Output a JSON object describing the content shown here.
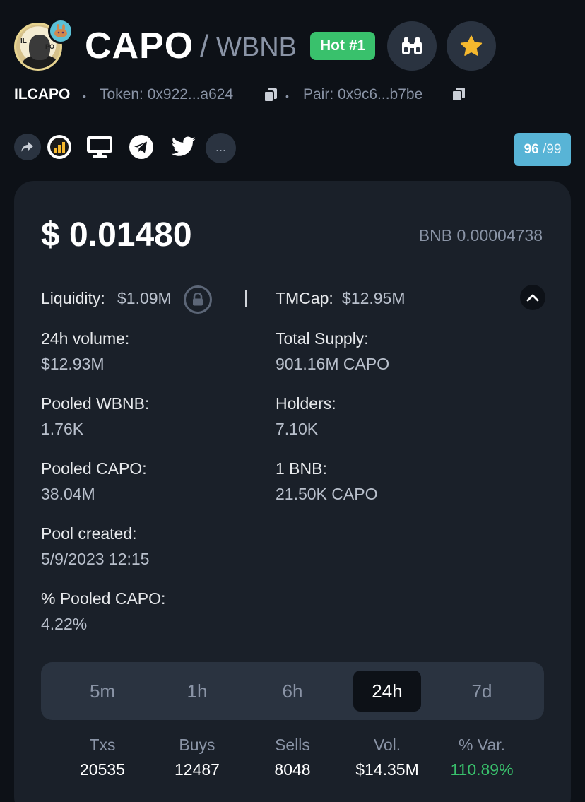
{
  "header": {
    "symbol": "CAPO",
    "slash": "/",
    "quote": "WBNB",
    "hot_badge": "Hot #1",
    "name": "ILCAPO",
    "token_label": "Token: 0x922...a624",
    "pair_label": "Pair: 0x9c6...b7be",
    "avatar_text_left": "IL",
    "avatar_text_right": "PO"
  },
  "score": {
    "value": "96",
    "max": "/99"
  },
  "more_label": "...",
  "price": {
    "usd": "$ 0.01480",
    "bnb": "BNB 0.00004738"
  },
  "stats_left": [
    {
      "label": "Liquidity:",
      "value": "$1.09M"
    },
    {
      "label": "24h volume:",
      "value": "$12.93M"
    },
    {
      "label": "Pooled WBNB:",
      "value": "1.76K"
    },
    {
      "label": "Pooled CAPO:",
      "value": "38.04M"
    },
    {
      "label": "Pool created:",
      "value": "5/9/2023 12:15"
    },
    {
      "label": "% Pooled CAPO:",
      "value": "4.22%"
    }
  ],
  "stats_right": [
    {
      "label": "TMCap:",
      "value": "$12.95M"
    },
    {
      "label": "Total Supply:",
      "value": "901.16M CAPO"
    },
    {
      "label": "Holders:",
      "value": "7.10K"
    },
    {
      "label": "1 BNB:",
      "value": "21.50K CAPO"
    }
  ],
  "timeframes": [
    "5m",
    "1h",
    "6h",
    "24h",
    "7d"
  ],
  "active_timeframe": "24h",
  "tx_stats": {
    "headers": [
      "Txs",
      "Buys",
      "Sells",
      "Vol.",
      "% Var."
    ],
    "values": [
      "20535",
      "12487",
      "8048",
      "$14.35M",
      "110.89%"
    ]
  },
  "colors": {
    "background": "#0d1117",
    "card": "#1a2029",
    "accent_green": "#39c16c",
    "score_blue": "#58b4d6",
    "star_gold": "#f5b82e"
  },
  "icons": [
    "share-icon",
    "chart-logo-icon",
    "website-icon",
    "telegram-icon",
    "twitter-icon",
    "binoculars-icon",
    "star-icon",
    "copy-icon",
    "lock-icon",
    "chevron-up-icon"
  ]
}
